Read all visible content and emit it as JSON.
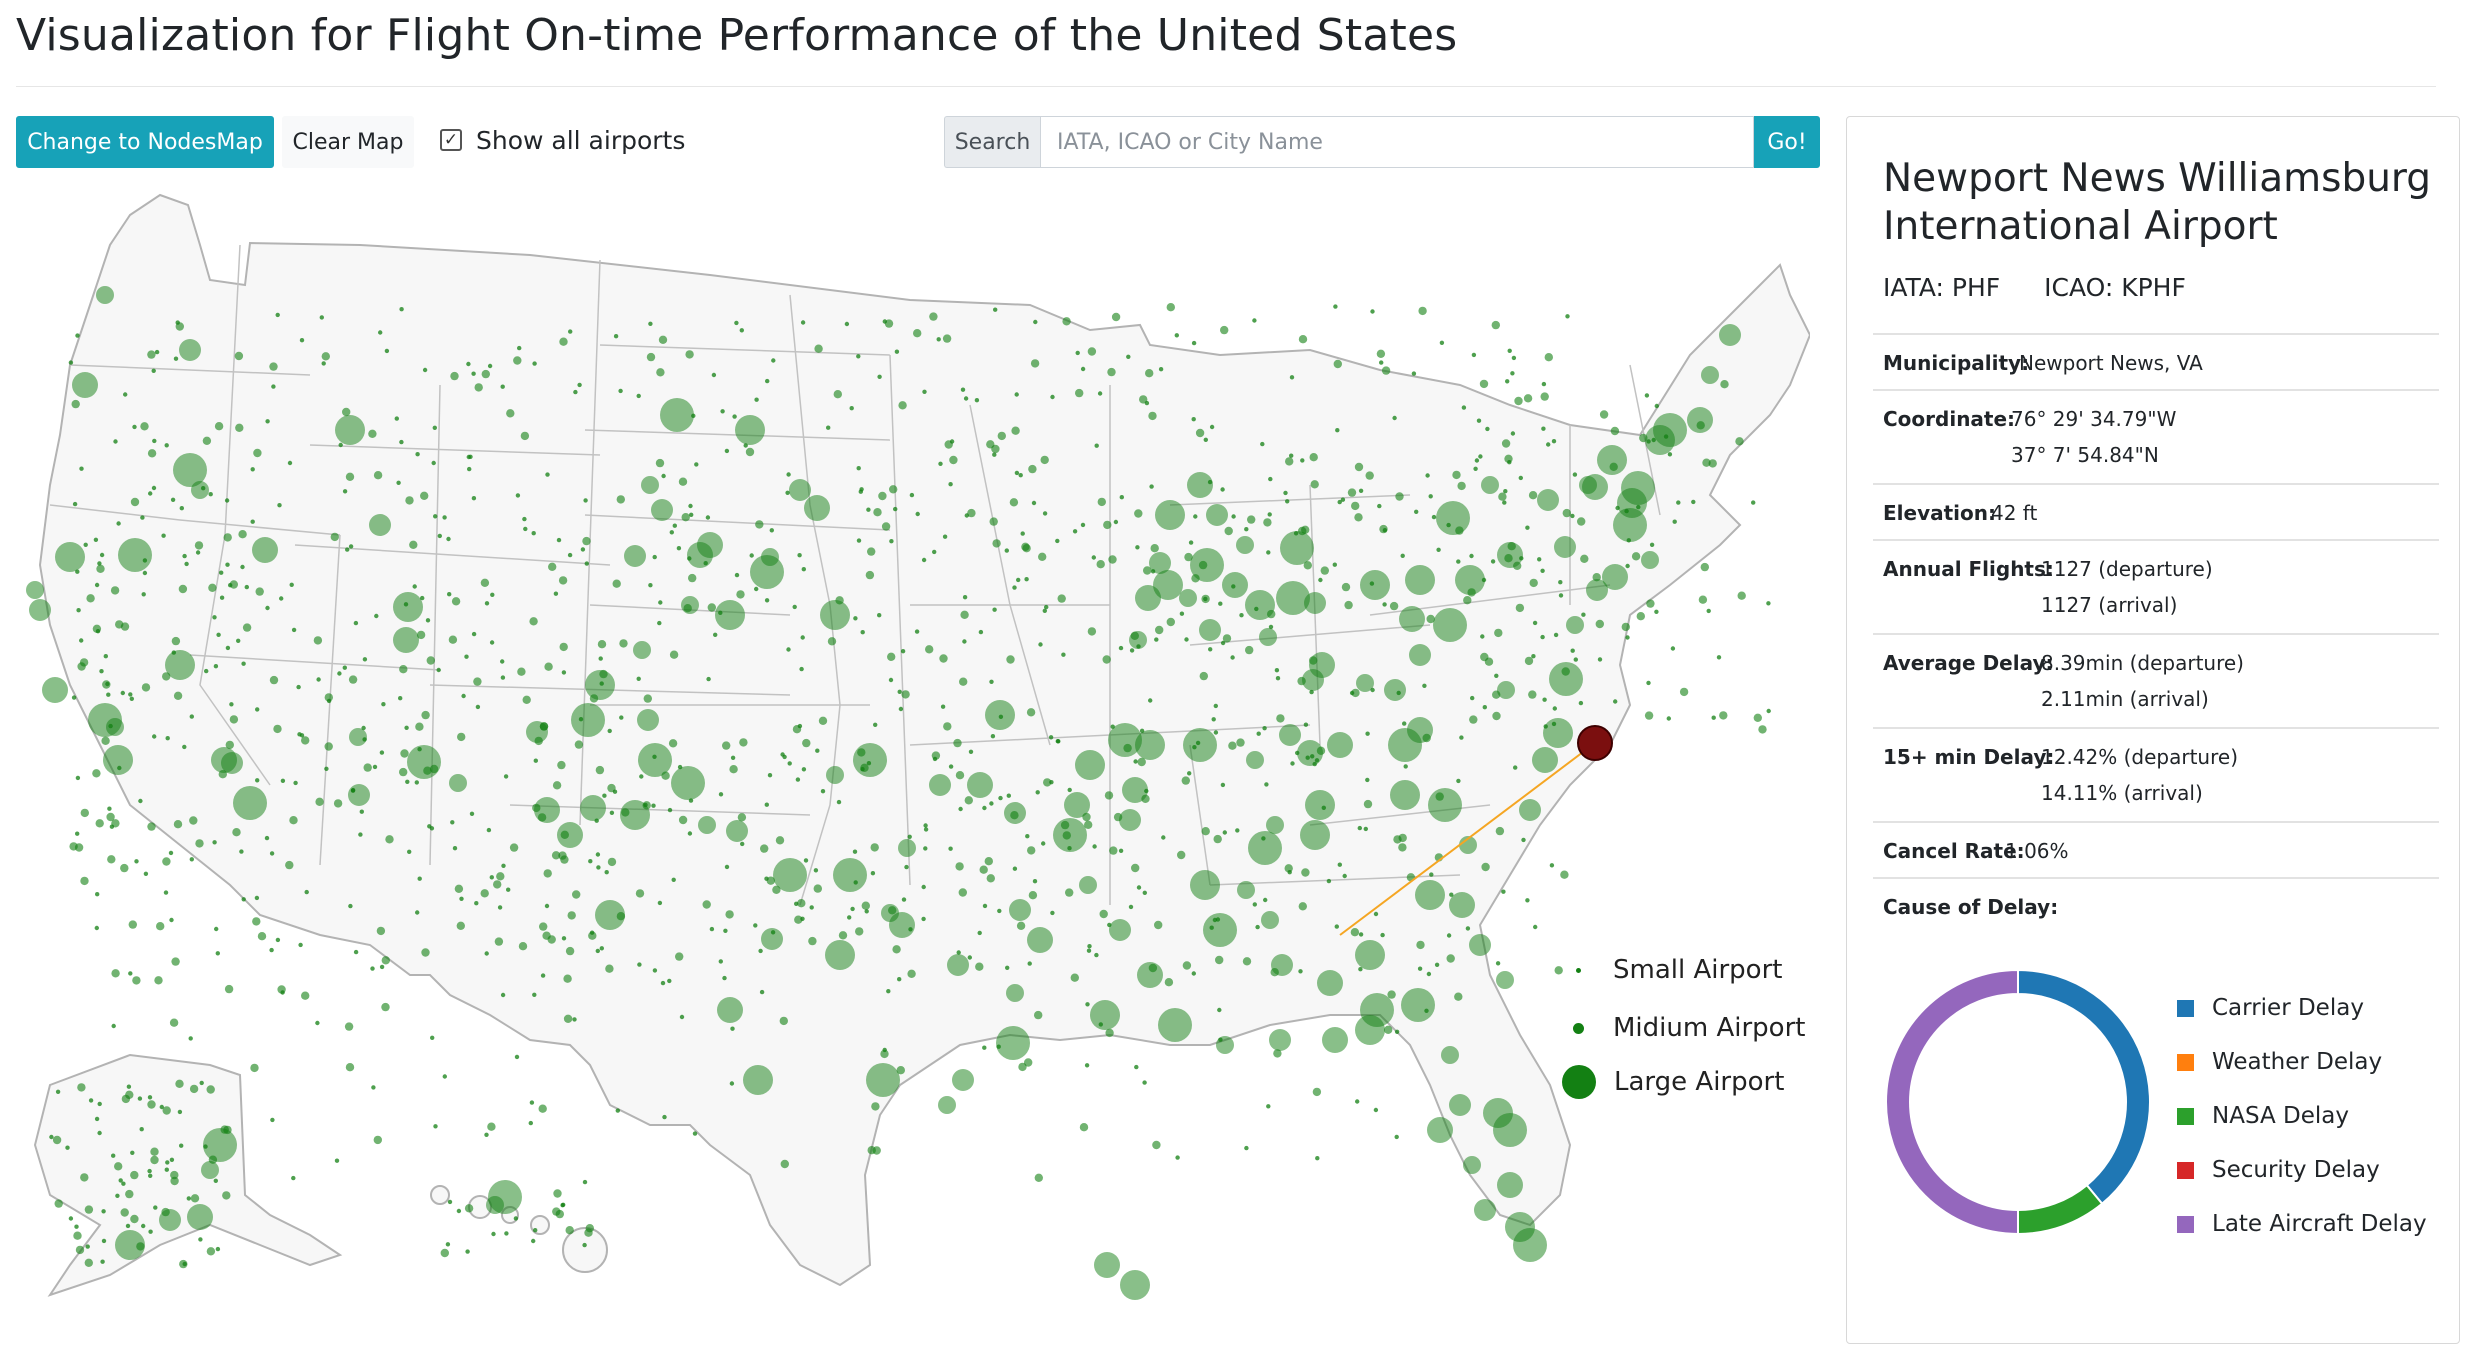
{
  "header": {
    "title": "Visualization for Flight On-time Performance of the United States"
  },
  "toolbar": {
    "change_button": "Change to NodesMap",
    "clear_button": "Clear Map",
    "show_all_label": "Show all airports",
    "show_all_checked": true,
    "search_addon": "Search",
    "search_placeholder": "IATA, ICAO or City Name",
    "search_value": "",
    "go_button": "Go!"
  },
  "map": {
    "land_color": "#f7f7f7",
    "border_color": "#b3b3b3",
    "airport_color": "#138013",
    "selected_color": "#7b0f0f",
    "route_color": "#f5a623",
    "legend": {
      "small": "Small Airport",
      "medium": "Midium Airport",
      "large": "Large Airport"
    }
  },
  "airport": {
    "name": "Newport News Williamsburg International Airport",
    "iata": "IATA: PHF",
    "icao": "ICAO: KPHF",
    "municipality_label": "Municipality:",
    "municipality": "Newport News, VA",
    "coordinate_label": "Coordinate:",
    "coordinate_lon": "76° 29' 34.79\"W",
    "coordinate_lat": "37° 7' 54.84\"N",
    "elevation_label": "Elevation:",
    "elevation": "42 ft",
    "flights_label": "Annual Flights:",
    "flights_departure": "1127 (departure)",
    "flights_arrival": "1127 (arrival)",
    "delay_label": "Average Delay:",
    "delay_departure": "8.39min (departure)",
    "delay_arrival": "2.11min (arrival)",
    "delay15_label": "15+ min Delay:",
    "delay15_departure": "12.42% (departure)",
    "delay15_arrival": "14.11% (arrival)",
    "cancel_label": "Cancel Rate:",
    "cancel_rate": "1.06%",
    "cause_label": "Cause of Delay:"
  },
  "chart_data": {
    "type": "pie",
    "categories": [
      "Carrier Delay",
      "Weather Delay",
      "NASA Delay",
      "Security Delay",
      "Late Aircraft Delay"
    ],
    "values": [
      39,
      0,
      11,
      0,
      50
    ],
    "colors": [
      "#1f77b4",
      "#ff7f0e",
      "#2ca02c",
      "#d62728",
      "#9467bd"
    ]
  }
}
